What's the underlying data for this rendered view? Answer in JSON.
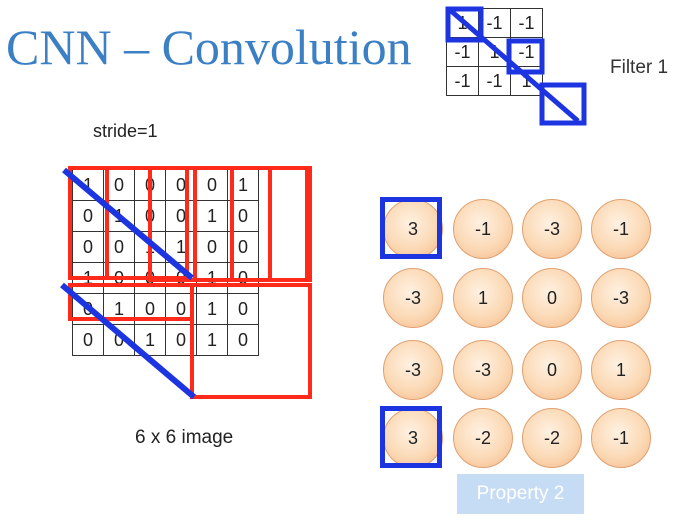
{
  "title": "CNN – Convolution",
  "filter": {
    "label": "Filter 1",
    "rows": [
      [
        "1",
        "-1",
        "-1"
      ],
      [
        "-1",
        "1",
        "-1"
      ],
      [
        "-1",
        "-1",
        "1"
      ]
    ]
  },
  "stride_label": "stride=1",
  "image": {
    "label": "6 x 6 image",
    "rows": [
      [
        "1",
        "0",
        "0",
        "0",
        "0",
        "1"
      ],
      [
        "0",
        "1",
        "0",
        "0",
        "1",
        "0"
      ],
      [
        "0",
        "0",
        "1",
        "1",
        "0",
        "0"
      ],
      [
        "1",
        "0",
        "0",
        "0",
        "1",
        "0"
      ],
      [
        "0",
        "1",
        "0",
        "0",
        "1",
        "0"
      ],
      [
        "0",
        "0",
        "1",
        "0",
        "1",
        "0"
      ]
    ]
  },
  "feature_map": {
    "rows": [
      [
        "3",
        "-1",
        "-3",
        "-1"
      ],
      [
        "-3",
        "1",
        "0",
        "-3"
      ],
      [
        "-3",
        "-3",
        "0",
        "1"
      ],
      [
        "3",
        "-2",
        "-2",
        "-1"
      ]
    ]
  },
  "property_label": "Property 2",
  "colors": {
    "title": "#3b7fc4",
    "highlight_box": "#1d35e0",
    "window_box": "#ff2a1a",
    "circle_fill": "#fbd9b5",
    "property_badge": "#c6dcf4"
  }
}
